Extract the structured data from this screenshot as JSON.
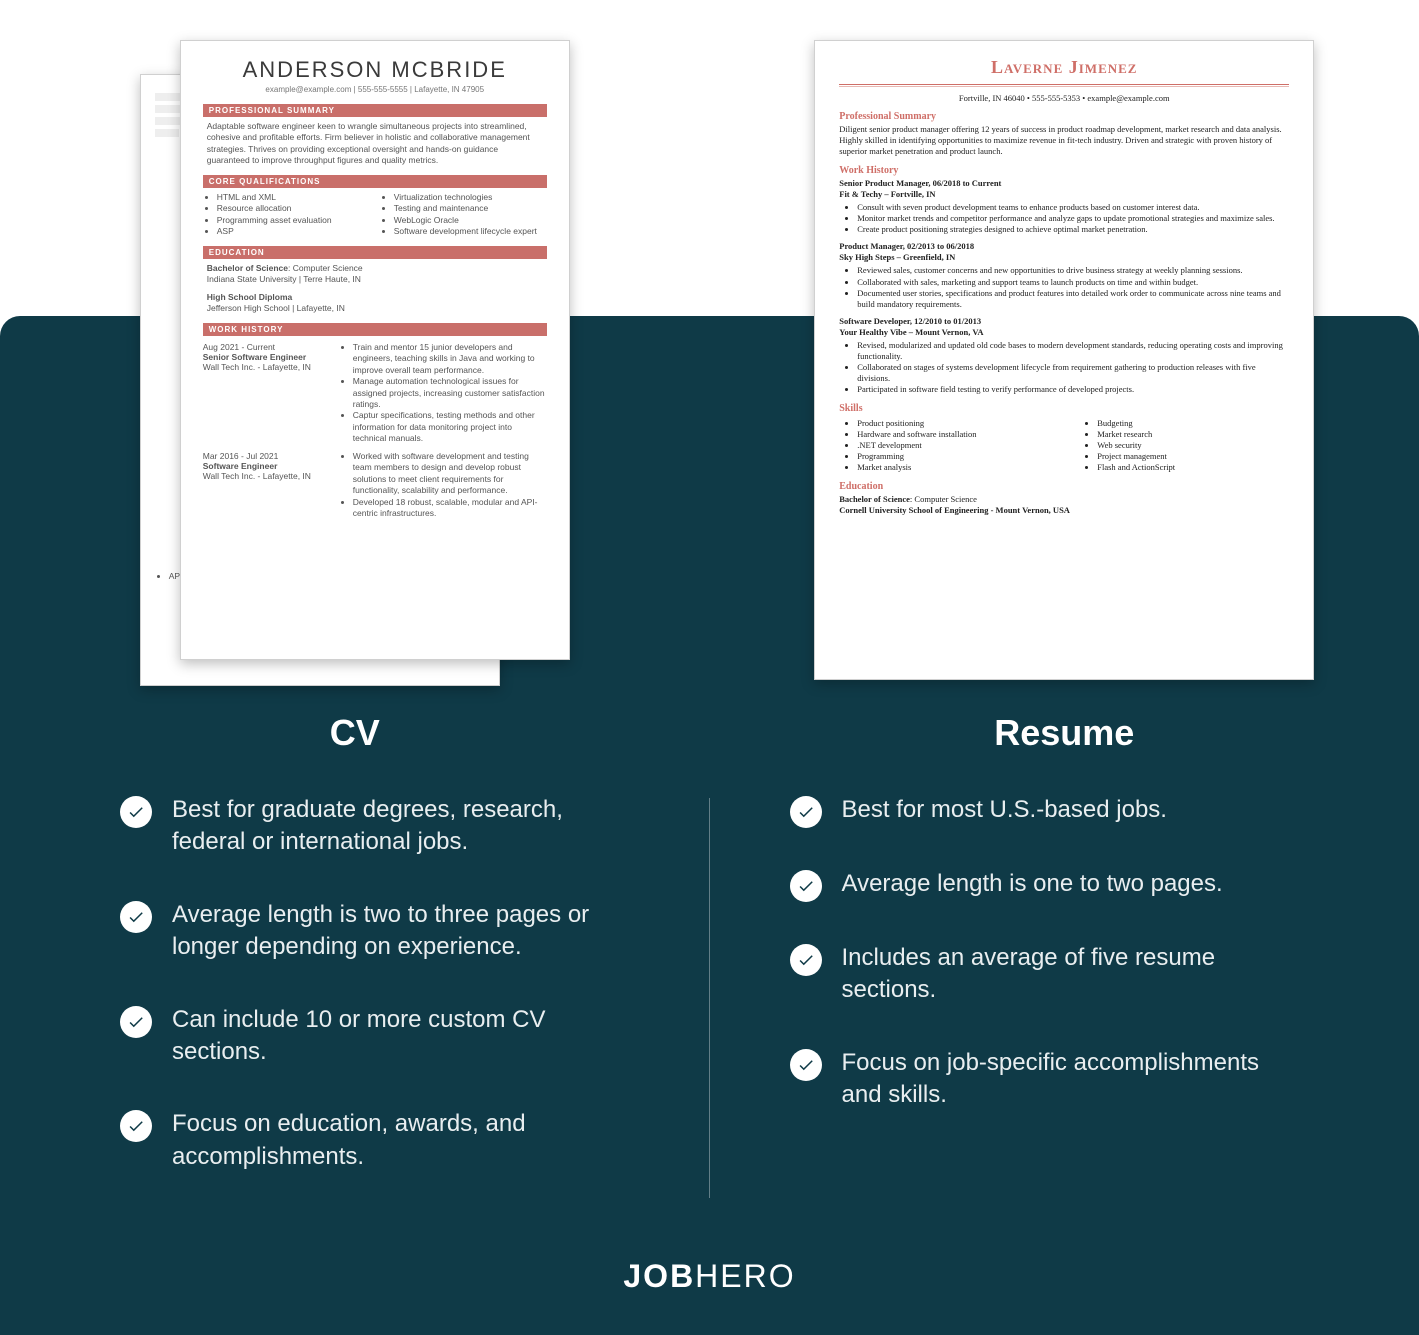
{
  "cv_document": {
    "name": "ANDERSON MCBRIDE",
    "contact": "example@example.com | 555-555-5555 | Lafayette, IN 47905",
    "sections": {
      "professional_summary": {
        "heading": "PROFESSIONAL SUMMARY",
        "text": "Adaptable software engineer keen to wrangle simultaneous projects into streamlined, cohesive and profitable efforts. Firm believer in holistic and collaborative management strategies. Thrives on providing exceptional oversight and hands-on guidance guaranteed to improve throughput figures and quality metrics."
      },
      "core_qualifications": {
        "heading": "CORE QUALIFICATIONS",
        "left": [
          "HTML and XML",
          "Resource allocation",
          "Programming asset evaluation",
          "ASP"
        ],
        "right": [
          "Virtualization technologies",
          "Testing and maintenance",
          "WebLogic Oracle",
          "Software development lifecycle expert"
        ]
      },
      "education": {
        "heading": "EDUCATION",
        "items": [
          {
            "degree_bold": "Bachelor of Science",
            "degree_rest": ": Computer Science",
            "school": "Indiana State University | Terre Haute, IN"
          },
          {
            "degree_bold": "High School Diploma",
            "degree_rest": "",
            "school": "Jefferson High School | Lafayette, IN"
          }
        ]
      },
      "work_history": {
        "heading": "WORK HISTORY",
        "jobs": [
          {
            "dates": "Aug 2021 - Current",
            "title": "Senior Software Engineer",
            "company": "Wall Tech Inc. - Lafayette, IN",
            "bullets": [
              "Train and mentor 15 junior developers and engineers, teaching skills in Java and working to improve overall team performance.",
              "Manage automation technological issues for assigned projects, increasing customer satisfaction ratings.",
              "Captur specifications, testing methods and other information for data monitoring project into technical manuals."
            ]
          },
          {
            "dates": "Mar 2016 - Jul 2021",
            "title": "Software Engineer",
            "company": "Wall Tech Inc. - Lafayette, IN",
            "bullets": [
              "Worked with software development and testing team members to design and develop robust solutions to meet client requirements for functionality, scalability and performance.",
              "Developed 18 robust, scalable, modular and API-centric infrastructures."
            ]
          }
        ]
      }
    },
    "back_page_stub": "API"
  },
  "resume_document": {
    "name": "Laverne Jimenez",
    "contact": "Fortville, IN 46040 • 555-555-5353 • example@example.com",
    "professional_summary": {
      "heading": "Professional Summary",
      "text": "Diligent senior product manager offering 12 years of success in product roadmap development, market research and data analysis. Highly skilled in identifying opportunities to maximize revenue in fit-tech industry. Driven and strategic with proven history of superior market penetration and product launch."
    },
    "work_history": {
      "heading": "Work History",
      "jobs": [
        {
          "title_line": "Senior Product Manager, 06/2018 to Current",
          "company_line": "Fit & Techy – Fortville, IN",
          "bullets": [
            "Consult with seven product development teams to enhance products based on customer interest data.",
            "Monitor market trends and competitor performance and analyze gaps to update promotional strategies and maximize sales.",
            "Create product positioning strategies designed to achieve optimal market penetration."
          ]
        },
        {
          "title_line": "Product Manager, 02/2013 to 06/2018",
          "company_line": "Sky High Steps – Greenfield, IN",
          "bullets": [
            "Reviewed sales, customer concerns and new opportunities to drive business strategy at weekly planning sessions.",
            "Collaborated with sales, marketing and support teams to launch products on time and within budget.",
            "Documented user stories, specifications and product features into detailed work order to communicate across nine teams and build mandatory requirements."
          ]
        },
        {
          "title_line": "Software Developer, 12/2010 to 01/2013",
          "company_line": "Your Healthy Vibe – Mount Vernon, VA",
          "bullets": [
            "Revised, modularized and updated old code bases to modern development standards, reducing operating costs and improving functionality.",
            "Collaborated on stages of systems development lifecycle from requirement gathering to production releases with five divisions.",
            "Participated in software field testing to verify performance of developed projects."
          ]
        }
      ]
    },
    "skills": {
      "heading": "Skills",
      "left": [
        "Product positioning",
        "Hardware and software installation",
        ".NET development",
        "Programming",
        "Market analysis"
      ],
      "right": [
        "Budgeting",
        "Market research",
        "Web security",
        "Project management",
        "Flash and ActionScript"
      ]
    },
    "education": {
      "heading": "Education",
      "degree_bold": "Bachelor of Science",
      "degree_rest": ": Computer Science",
      "school": "Cornell University School of Engineering - Mount Vernon, USA"
    }
  },
  "labels": {
    "cv_title": "CV",
    "resume_title": "Resume"
  },
  "cv_points": [
    "Best for graduate degrees, research, federal or international jobs.",
    "Average length is two to three pages or longer depending on experience.",
    "Can include 10 or more custom CV sections.",
    "Focus on education, awards, and accomplishments."
  ],
  "resume_points": [
    "Best for most U.S.-based jobs.",
    "Average length is one to two pages.",
    "Includes an average of five resume sections.",
    "Focus on job-specific accomplishments and skills."
  ],
  "brand": {
    "bold": "JOB",
    "light": "HERO"
  }
}
